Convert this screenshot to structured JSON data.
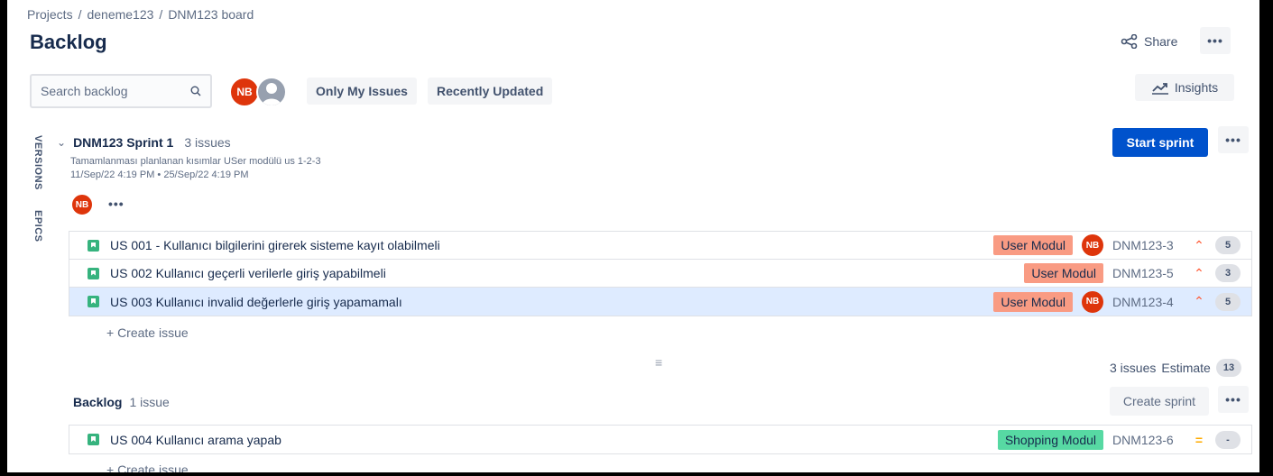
{
  "breadcrumb": {
    "items": [
      "Projects",
      "deneme123",
      "DNM123 board"
    ],
    "separator": "/"
  },
  "page": {
    "title": "Backlog"
  },
  "header": {
    "share_label": "Share",
    "more_label": "•••",
    "insights_label": "Insights"
  },
  "toolbar": {
    "search_placeholder": "Search backlog",
    "avatar_initials": "NB",
    "filter_only_mine": "Only My Issues",
    "filter_recent": "Recently Updated"
  },
  "sidebar": {
    "versions_label": "VERSIONS",
    "epics_label": "EPICS"
  },
  "sprint": {
    "name": "DNM123 Sprint 1",
    "count_label": "3 issues",
    "goal": "Tamamlanması planlanan kısımlar USer modülü us 1-2-3",
    "dates": "11/Sep/22 4:19 PM • 25/Sep/22 4:19 PM",
    "avatar_initials": "NB",
    "more_label": "•••",
    "start_label": "Start sprint",
    "issues": [
      {
        "summary": "US 001 - Kullanıcı bilgilerini girerek sisteme kayıt olabilmeli",
        "epic": "User Modul",
        "assignee": "NB",
        "key": "DNM123-3",
        "points": "5"
      },
      {
        "summary": "US 002 Kullanıcı geçerli verilerle giriş yapabilmeli",
        "epic": "User Modul",
        "assignee": "",
        "key": "DNM123-5",
        "points": "3"
      },
      {
        "summary": "US 003 Kullanıcı invalid değerlerle giriş yapamamalı",
        "epic": "User Modul",
        "assignee": "NB",
        "key": "DNM123-4",
        "points": "5"
      }
    ],
    "create_issue_label": "+ Create issue",
    "footer_count": "3 issues",
    "footer_estimate_label": "Estimate",
    "footer_estimate_value": "13"
  },
  "backlog": {
    "title": "Backlog",
    "count_label": "1 issue",
    "create_sprint_label": "Create sprint",
    "more_label": "•••",
    "issues": [
      {
        "summary": "US 004 Kullanıcı arama yapab",
        "epic": "Shopping Modul",
        "key": "DNM123-6",
        "points": "-"
      }
    ],
    "create_issue_label": "+ Create issue"
  },
  "colors": {
    "primary": "#0052cc",
    "epic_user": "#f99b83",
    "epic_shopping": "#57d9a3",
    "avatar": "#de350b",
    "selected_row": "#deebff"
  },
  "icons": {
    "share": "share-icon",
    "insights": "insights-icon",
    "search": "search-icon",
    "story": "story-icon",
    "priority_high": "priority-high-icon",
    "priority_medium": "priority-medium-icon"
  }
}
